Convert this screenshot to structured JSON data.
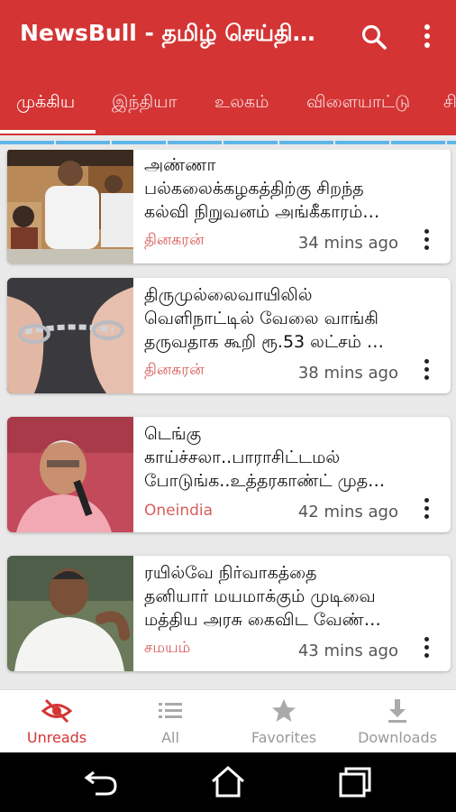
{
  "appbar": {
    "title": "NewsBull - தமிழ் செய்தி…",
    "search_icon": "search-icon",
    "more_icon": "more-vert-icon"
  },
  "tabs": [
    {
      "label": "முக்கிய",
      "active": true
    },
    {
      "label": "இந்தியா",
      "active": false
    },
    {
      "label": "உலகம்",
      "active": false
    },
    {
      "label": "விளையாட்டு",
      "active": false
    },
    {
      "label": "சி",
      "active": false
    }
  ],
  "articles": [
    {
      "lines": [
        "அண்ணா",
        "பல்கலைக்கழகத்திற்கு சிறந்த",
        "கல்வி நிறுவனம் அங்கீகாரம்…"
      ],
      "source": "தினகரன்",
      "time": "34 mins ago"
    },
    {
      "lines": [
        "திருமுல்லைவாயிலில்",
        "வெளிநாட்டில் வேலை வாங்கி",
        "தருவதாக கூறி ரூ.53 லட்சம் …"
      ],
      "source": "தினகரன்",
      "time": "38 mins ago"
    },
    {
      "lines": [
        "டெங்கு",
        "காய்ச்சலா..பாராசிட்டமல்",
        "போடுங்க..உத்தரகாண்ட் முத…"
      ],
      "source": "Oneindia",
      "time": "42 mins ago"
    },
    {
      "lines": [
        "ரயில்வே நிர்வாகத்தை",
        "தனியார் மயமாக்கும் முடிவை",
        "மத்திய அரசு கைவிட வேண்…"
      ],
      "source": "சமயம்",
      "time": "43 mins ago"
    }
  ],
  "bottom_nav": [
    {
      "label": "Unreads",
      "icon": "eye-off-icon",
      "active": true
    },
    {
      "label": "All",
      "icon": "list-icon",
      "active": false
    },
    {
      "label": "Favorites",
      "icon": "star-icon",
      "active": false
    },
    {
      "label": "Downloads",
      "icon": "download-icon",
      "active": false
    }
  ],
  "colors": {
    "primary": "#d43434",
    "source_text": "#d85c5c",
    "strip": "#5eb6e8"
  }
}
